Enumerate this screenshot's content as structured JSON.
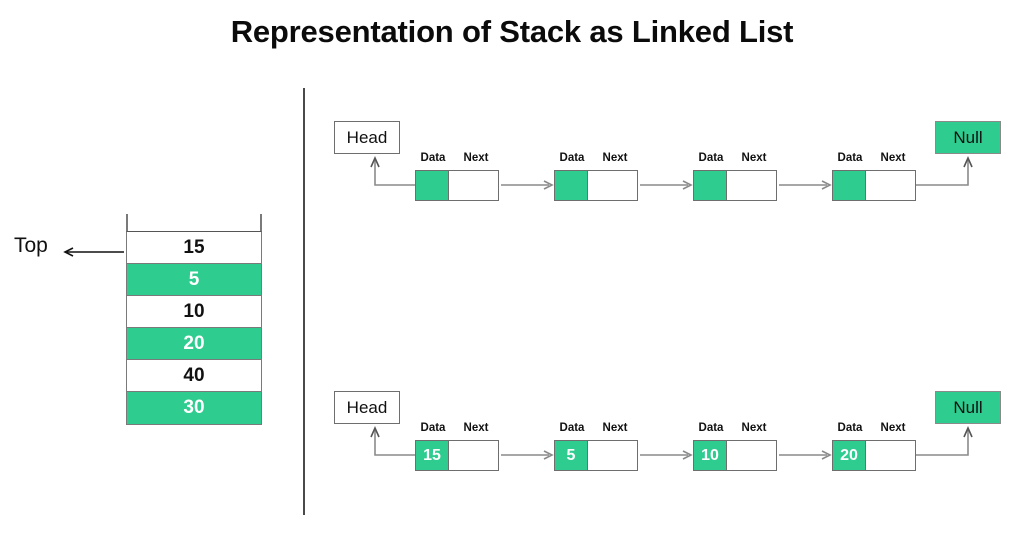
{
  "title": "Representation of Stack as Linked List",
  "colors": {
    "green": "#2ECC8F",
    "border": "#6e6e6e",
    "arrow": "#8a8a8a",
    "text": "#111111"
  },
  "stack": {
    "top_label": "Top",
    "top_arrow_icon": "left-arrow-icon",
    "cells": [
      {
        "value": "15",
        "fill": "white"
      },
      {
        "value": "5",
        "fill": "green"
      },
      {
        "value": "10",
        "fill": "white"
      },
      {
        "value": "20",
        "fill": "green"
      },
      {
        "value": "40",
        "fill": "white"
      },
      {
        "value": "30",
        "fill": "green"
      }
    ]
  },
  "linked_lists": [
    {
      "id": "top-row",
      "head_label": "Head",
      "null_label": "Null",
      "node_labels": {
        "data": "Data",
        "next": "Next"
      },
      "nodes": [
        {
          "data": ""
        },
        {
          "data": ""
        },
        {
          "data": ""
        },
        {
          "data": ""
        }
      ]
    },
    {
      "id": "bottom-row",
      "head_label": "Head",
      "null_label": "Null",
      "node_labels": {
        "data": "Data",
        "next": "Next"
      },
      "nodes": [
        {
          "data": "15"
        },
        {
          "data": "5"
        },
        {
          "data": "10"
        },
        {
          "data": "20"
        }
      ]
    }
  ]
}
